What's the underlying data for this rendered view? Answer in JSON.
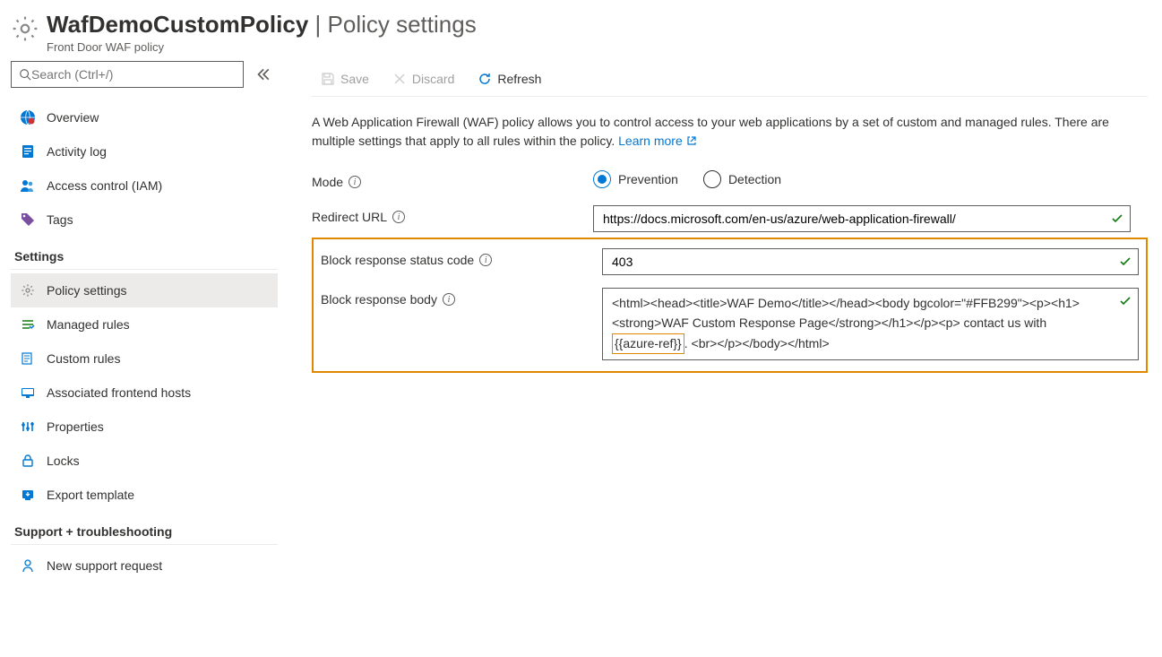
{
  "header": {
    "resource_name": "WafDemoCustomPolicy",
    "page_name": "Policy settings",
    "subtitle": "Front Door WAF policy"
  },
  "sidebar": {
    "search_placeholder": "Search (Ctrl+/)",
    "items_top": [
      {
        "label": "Overview"
      },
      {
        "label": "Activity log"
      },
      {
        "label": "Access control (IAM)"
      },
      {
        "label": "Tags"
      }
    ],
    "section_settings": "Settings",
    "items_settings": [
      {
        "label": "Policy settings"
      },
      {
        "label": "Managed rules"
      },
      {
        "label": "Custom rules"
      },
      {
        "label": "Associated frontend hosts"
      },
      {
        "label": "Properties"
      },
      {
        "label": "Locks"
      },
      {
        "label": "Export template"
      }
    ],
    "section_support": "Support + troubleshooting",
    "items_support": [
      {
        "label": "New support request"
      }
    ]
  },
  "toolbar": {
    "save": "Save",
    "discard": "Discard",
    "refresh": "Refresh"
  },
  "main": {
    "intro_text": "A Web Application Firewall (WAF) policy allows you to control access to your web applications by a set of custom and managed rules. There are multiple settings that apply to all rules within the policy. ",
    "learn_more": "Learn more",
    "fields": {
      "mode_label": "Mode",
      "mode_options": {
        "prevention": "Prevention",
        "detection": "Detection"
      },
      "mode_value": "Prevention",
      "redirect_label": "Redirect URL",
      "redirect_value": "https://docs.microsoft.com/en-us/azure/web-application-firewall/",
      "status_label": "Block response status code",
      "status_value": "403",
      "body_label": "Block response body",
      "body_prefix": "<html><head><title>WAF Demo</title></head><body bgcolor=\"#FFB299\"><p><h1><strong>WAF Custom Response Page</strong></h1></p><p> contact us with ",
      "body_highlight": "{{azure-ref}}",
      "body_suffix": ". <br></p></body></html>"
    }
  }
}
